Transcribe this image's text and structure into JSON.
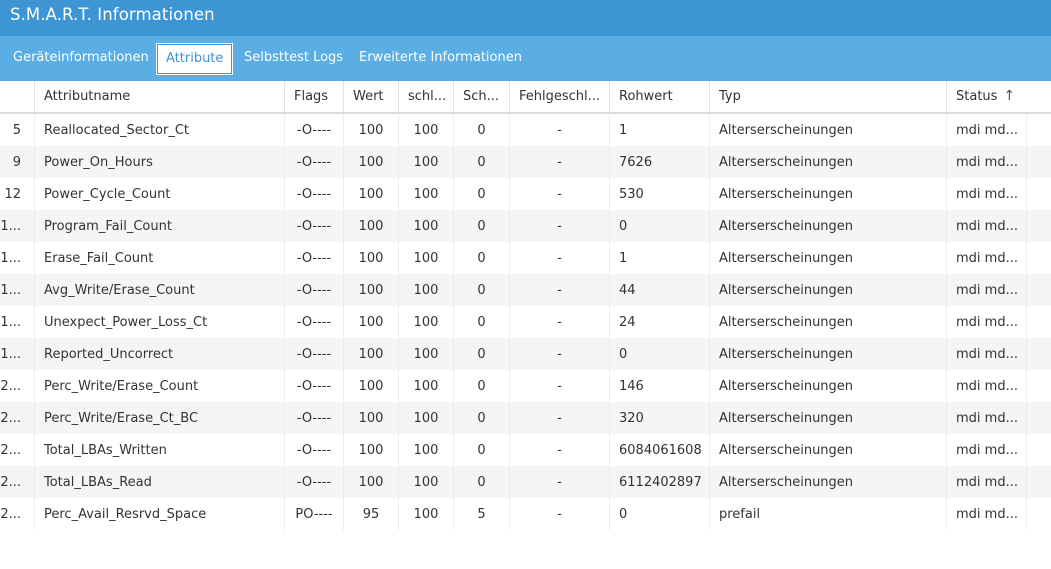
{
  "window": {
    "title": "S.M.A.R.T. Informationen"
  },
  "tabs": [
    {
      "label": "Geräteinformationen",
      "active": false
    },
    {
      "label": "Attribute",
      "active": true
    },
    {
      "label": "Selbsttest Logs",
      "active": false
    },
    {
      "label": "Erweiterte Informationen",
      "active": false
    }
  ],
  "table": {
    "columns": [
      "",
      "Attributname",
      "Flags",
      "Wert",
      "schl...",
      "Sch...",
      "Fehlgeschl...",
      "Rohwert",
      "Typ",
      "Status"
    ],
    "sort_indicator": "↑",
    "rows": [
      {
        "id": "5",
        "name": "Reallocated_Sector_Ct",
        "flags": "-O----",
        "value": "100",
        "worst": "100",
        "thresh": "0",
        "failed": "-",
        "raw": "1",
        "type": "Alterserscheinungen",
        "status": "mdi md..."
      },
      {
        "id": "9",
        "name": "Power_On_Hours",
        "flags": "-O----",
        "value": "100",
        "worst": "100",
        "thresh": "0",
        "failed": "-",
        "raw": "7626",
        "type": "Alterserscheinungen",
        "status": "mdi md..."
      },
      {
        "id": "12",
        "name": "Power_Cycle_Count",
        "flags": "-O----",
        "value": "100",
        "worst": "100",
        "thresh": "0",
        "failed": "-",
        "raw": "530",
        "type": "Alterserscheinungen",
        "status": "mdi md..."
      },
      {
        "id": "1...",
        "name": "Program_Fail_Count",
        "flags": "-O----",
        "value": "100",
        "worst": "100",
        "thresh": "0",
        "failed": "-",
        "raw": "0",
        "type": "Alterserscheinungen",
        "status": "mdi md..."
      },
      {
        "id": "1...",
        "name": "Erase_Fail_Count",
        "flags": "-O----",
        "value": "100",
        "worst": "100",
        "thresh": "0",
        "failed": "-",
        "raw": "1",
        "type": "Alterserscheinungen",
        "status": "mdi md..."
      },
      {
        "id": "1...",
        "name": "Avg_Write/Erase_Count",
        "flags": "-O----",
        "value": "100",
        "worst": "100",
        "thresh": "0",
        "failed": "-",
        "raw": "44",
        "type": "Alterserscheinungen",
        "status": "mdi md..."
      },
      {
        "id": "1...",
        "name": "Unexpect_Power_Loss_Ct",
        "flags": "-O----",
        "value": "100",
        "worst": "100",
        "thresh": "0",
        "failed": "-",
        "raw": "24",
        "type": "Alterserscheinungen",
        "status": "mdi md..."
      },
      {
        "id": "1...",
        "name": "Reported_Uncorrect",
        "flags": "-O----",
        "value": "100",
        "worst": "100",
        "thresh": "0",
        "failed": "-",
        "raw": "0",
        "type": "Alterserscheinungen",
        "status": "mdi md..."
      },
      {
        "id": "2...",
        "name": "Perc_Write/Erase_Count",
        "flags": "-O----",
        "value": "100",
        "worst": "100",
        "thresh": "0",
        "failed": "-",
        "raw": "146",
        "type": "Alterserscheinungen",
        "status": "mdi md..."
      },
      {
        "id": "2...",
        "name": "Perc_Write/Erase_Ct_BC",
        "flags": "-O----",
        "value": "100",
        "worst": "100",
        "thresh": "0",
        "failed": "-",
        "raw": "320",
        "type": "Alterserscheinungen",
        "status": "mdi md..."
      },
      {
        "id": "2...",
        "name": "Total_LBAs_Written",
        "flags": "-O----",
        "value": "100",
        "worst": "100",
        "thresh": "0",
        "failed": "-",
        "raw": "6084061608",
        "type": "Alterserscheinungen",
        "status": "mdi md..."
      },
      {
        "id": "2...",
        "name": "Total_LBAs_Read",
        "flags": "-O----",
        "value": "100",
        "worst": "100",
        "thresh": "0",
        "failed": "-",
        "raw": "6112402897",
        "type": "Alterserscheinungen",
        "status": "mdi md..."
      },
      {
        "id": "2...",
        "name": "Perc_Avail_Resrvd_Space",
        "flags": "PO----",
        "value": "95",
        "worst": "100",
        "thresh": "5",
        "failed": "-",
        "raw": "0",
        "type": "prefail",
        "status": "mdi md..."
      }
    ]
  },
  "colors": {
    "titlebar": "#3d95d3",
    "tabbar": "#5aaee3",
    "row_alt": "#f5f5f5"
  }
}
